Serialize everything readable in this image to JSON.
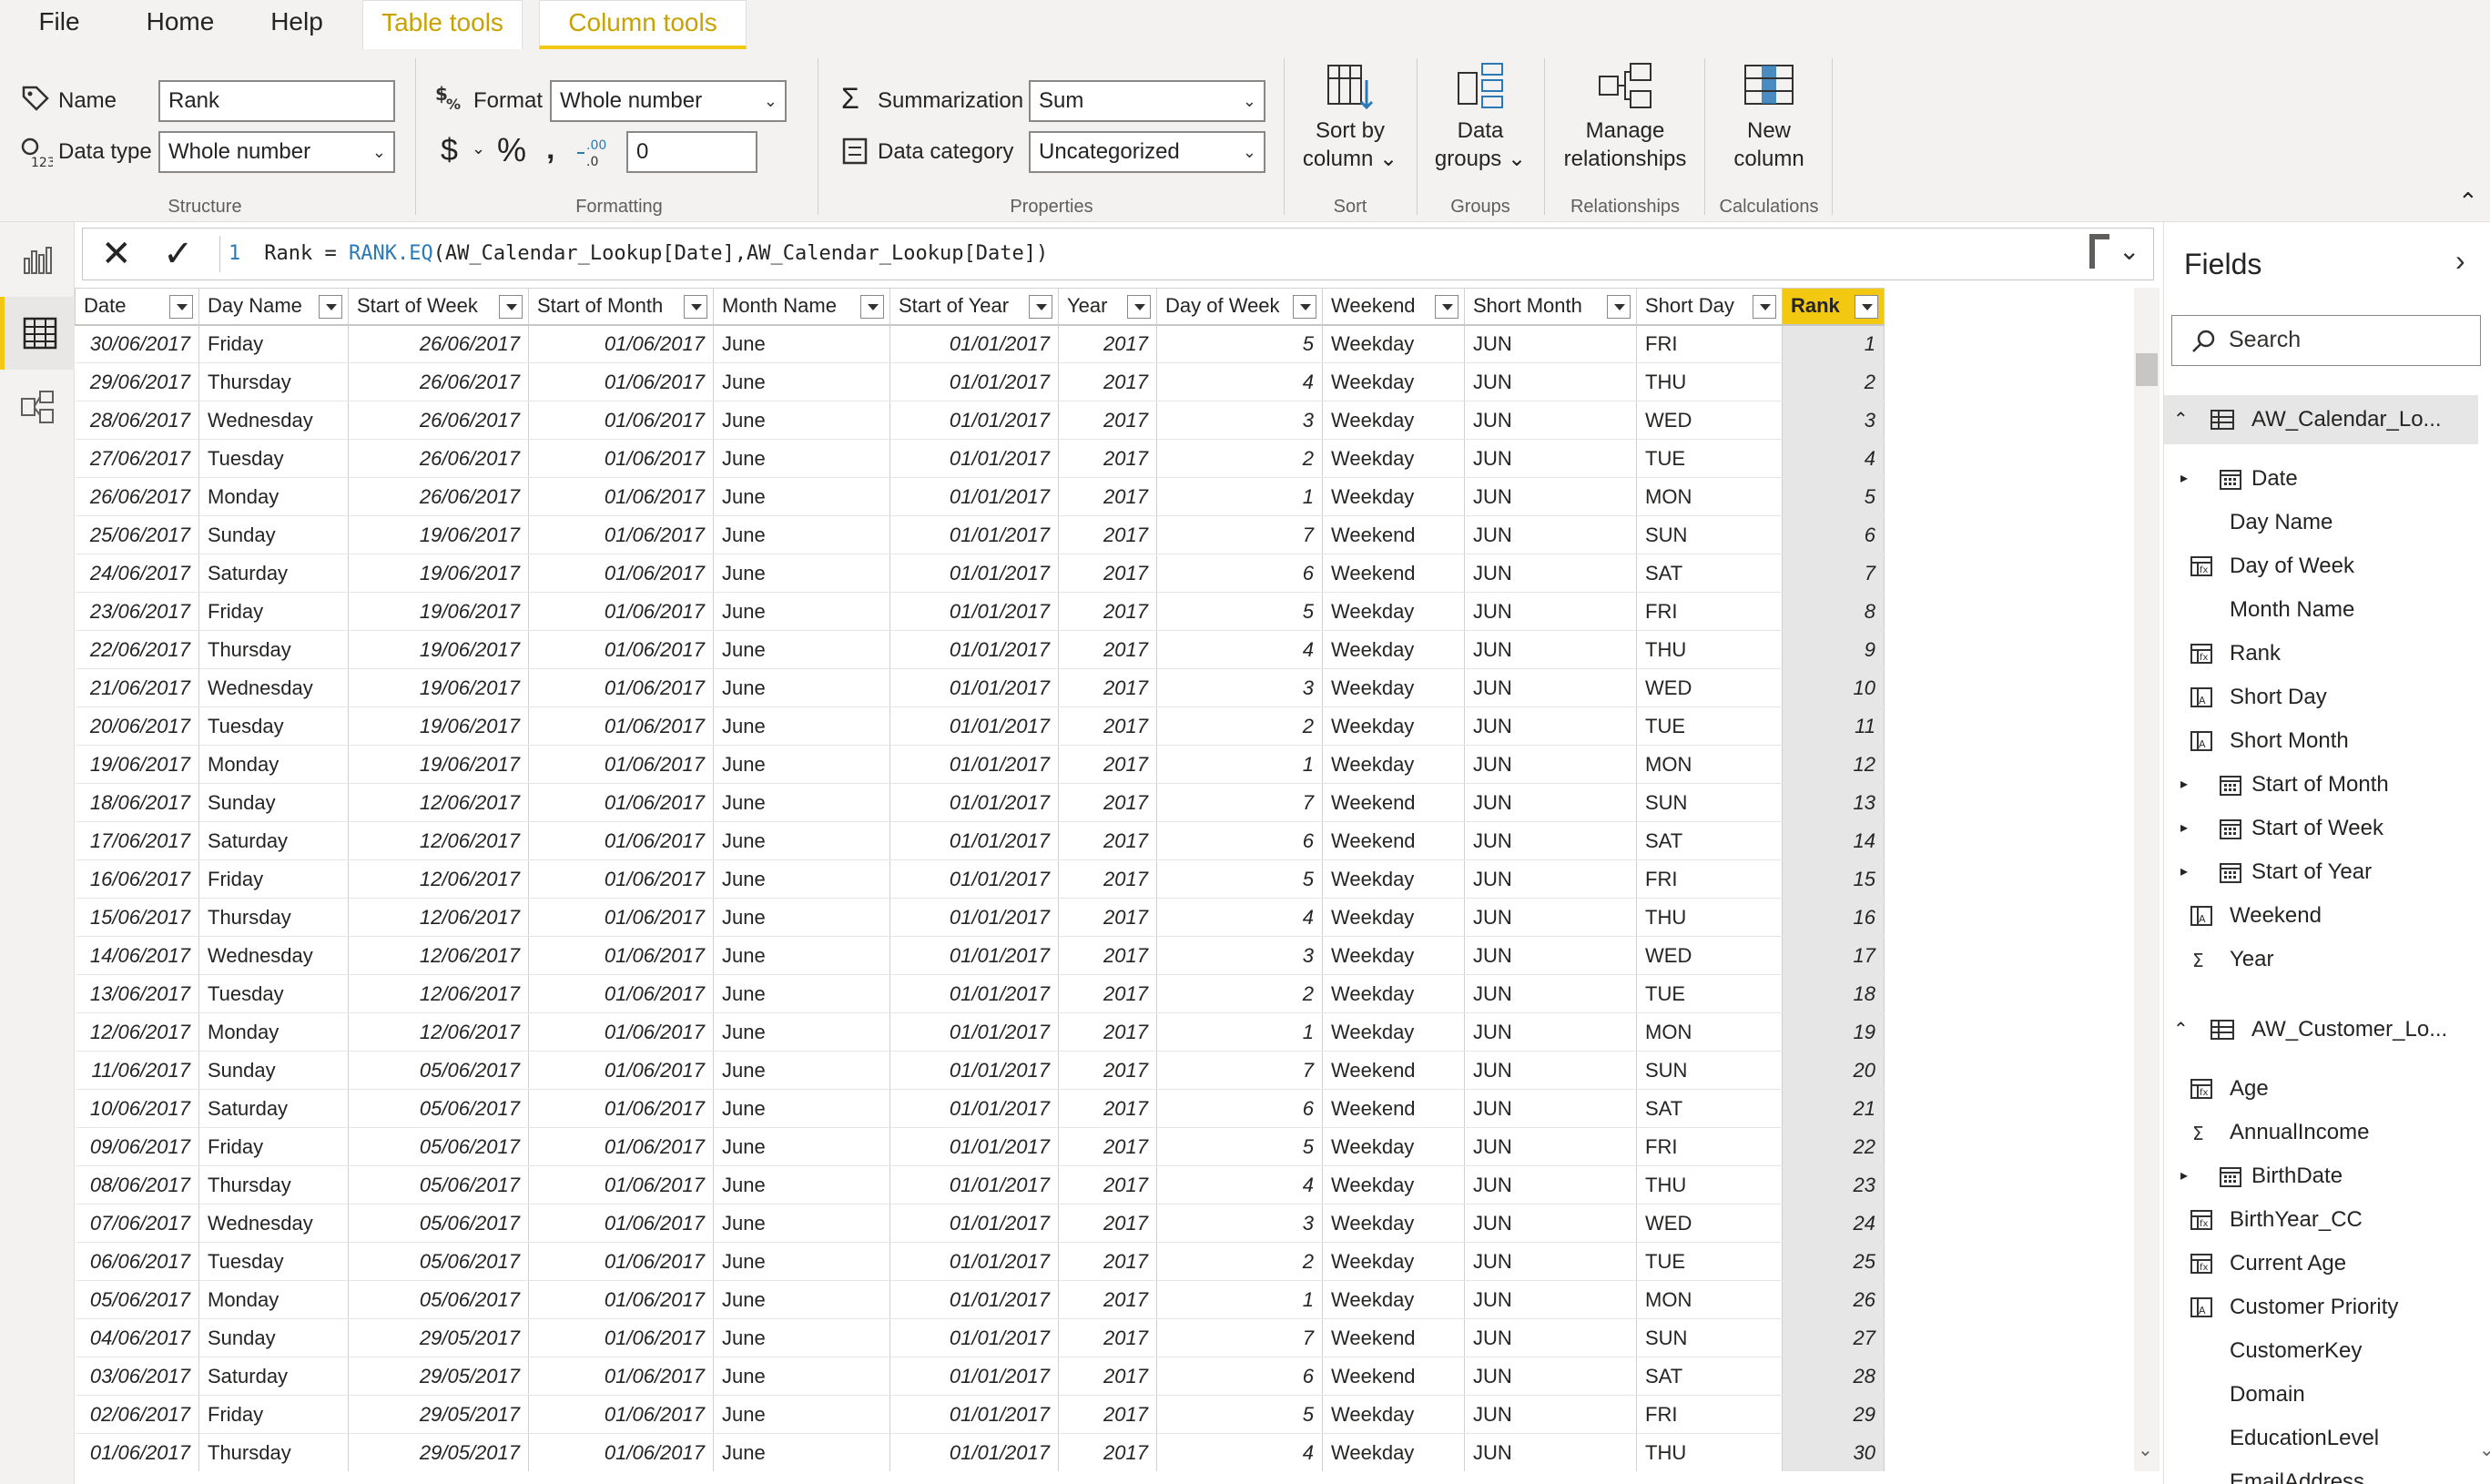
{
  "tabs": [
    {
      "label": "File"
    },
    {
      "label": "Home"
    },
    {
      "label": "Help"
    },
    {
      "label": "Table tools"
    },
    {
      "label": "Column tools"
    }
  ],
  "structure": {
    "name_label": "Name",
    "name_value": "Rank",
    "datatype_label": "Data type",
    "datatype_value": "Whole number",
    "group_label": "Structure"
  },
  "formatting": {
    "format_label": "Format",
    "format_value": "Whole number",
    "decimals_value": "0",
    "group_label": "Formatting"
  },
  "properties": {
    "summarization_label": "Summarization",
    "summarization_value": "Sum",
    "category_label": "Data category",
    "category_value": "Uncategorized",
    "group_label": "Properties"
  },
  "sort": {
    "line1": "Sort by",
    "line2": "column",
    "group_label": "Sort"
  },
  "groups": {
    "line1": "Data",
    "line2": "groups",
    "group_label": "Groups"
  },
  "relationships": {
    "line1": "Manage",
    "line2": "relationships",
    "group_label": "Relationships"
  },
  "calculations": {
    "line1": "New",
    "line2": "column",
    "group_label": "Calculations"
  },
  "formula": {
    "line_number": "1",
    "prefix": "Rank = ",
    "function": "RANK.EQ",
    "args": "(AW_Calendar_Lookup[Date],AW_Calendar_Lookup[Date])"
  },
  "table": {
    "columns": [
      "Date",
      "Day Name",
      "Start of Week",
      "Start of Month",
      "Month Name",
      "Start of Year",
      "Year",
      "Day of Week",
      "Weekend",
      "Short Month",
      "Short Day",
      "Rank"
    ],
    "rows": [
      [
        "30/06/2017",
        "Friday",
        "26/06/2017",
        "01/06/2017",
        "June",
        "01/01/2017",
        "2017",
        "5",
        "Weekday",
        "JUN",
        "FRI",
        "1"
      ],
      [
        "29/06/2017",
        "Thursday",
        "26/06/2017",
        "01/06/2017",
        "June",
        "01/01/2017",
        "2017",
        "4",
        "Weekday",
        "JUN",
        "THU",
        "2"
      ],
      [
        "28/06/2017",
        "Wednesday",
        "26/06/2017",
        "01/06/2017",
        "June",
        "01/01/2017",
        "2017",
        "3",
        "Weekday",
        "JUN",
        "WED",
        "3"
      ],
      [
        "27/06/2017",
        "Tuesday",
        "26/06/2017",
        "01/06/2017",
        "June",
        "01/01/2017",
        "2017",
        "2",
        "Weekday",
        "JUN",
        "TUE",
        "4"
      ],
      [
        "26/06/2017",
        "Monday",
        "26/06/2017",
        "01/06/2017",
        "June",
        "01/01/2017",
        "2017",
        "1",
        "Weekday",
        "JUN",
        "MON",
        "5"
      ],
      [
        "25/06/2017",
        "Sunday",
        "19/06/2017",
        "01/06/2017",
        "June",
        "01/01/2017",
        "2017",
        "7",
        "Weekend",
        "JUN",
        "SUN",
        "6"
      ],
      [
        "24/06/2017",
        "Saturday",
        "19/06/2017",
        "01/06/2017",
        "June",
        "01/01/2017",
        "2017",
        "6",
        "Weekend",
        "JUN",
        "SAT",
        "7"
      ],
      [
        "23/06/2017",
        "Friday",
        "19/06/2017",
        "01/06/2017",
        "June",
        "01/01/2017",
        "2017",
        "5",
        "Weekday",
        "JUN",
        "FRI",
        "8"
      ],
      [
        "22/06/2017",
        "Thursday",
        "19/06/2017",
        "01/06/2017",
        "June",
        "01/01/2017",
        "2017",
        "4",
        "Weekday",
        "JUN",
        "THU",
        "9"
      ],
      [
        "21/06/2017",
        "Wednesday",
        "19/06/2017",
        "01/06/2017",
        "June",
        "01/01/2017",
        "2017",
        "3",
        "Weekday",
        "JUN",
        "WED",
        "10"
      ],
      [
        "20/06/2017",
        "Tuesday",
        "19/06/2017",
        "01/06/2017",
        "June",
        "01/01/2017",
        "2017",
        "2",
        "Weekday",
        "JUN",
        "TUE",
        "11"
      ],
      [
        "19/06/2017",
        "Monday",
        "19/06/2017",
        "01/06/2017",
        "June",
        "01/01/2017",
        "2017",
        "1",
        "Weekday",
        "JUN",
        "MON",
        "12"
      ],
      [
        "18/06/2017",
        "Sunday",
        "12/06/2017",
        "01/06/2017",
        "June",
        "01/01/2017",
        "2017",
        "7",
        "Weekend",
        "JUN",
        "SUN",
        "13"
      ],
      [
        "17/06/2017",
        "Saturday",
        "12/06/2017",
        "01/06/2017",
        "June",
        "01/01/2017",
        "2017",
        "6",
        "Weekend",
        "JUN",
        "SAT",
        "14"
      ],
      [
        "16/06/2017",
        "Friday",
        "12/06/2017",
        "01/06/2017",
        "June",
        "01/01/2017",
        "2017",
        "5",
        "Weekday",
        "JUN",
        "FRI",
        "15"
      ],
      [
        "15/06/2017",
        "Thursday",
        "12/06/2017",
        "01/06/2017",
        "June",
        "01/01/2017",
        "2017",
        "4",
        "Weekday",
        "JUN",
        "THU",
        "16"
      ],
      [
        "14/06/2017",
        "Wednesday",
        "12/06/2017",
        "01/06/2017",
        "June",
        "01/01/2017",
        "2017",
        "3",
        "Weekday",
        "JUN",
        "WED",
        "17"
      ],
      [
        "13/06/2017",
        "Tuesday",
        "12/06/2017",
        "01/06/2017",
        "June",
        "01/01/2017",
        "2017",
        "2",
        "Weekday",
        "JUN",
        "TUE",
        "18"
      ],
      [
        "12/06/2017",
        "Monday",
        "12/06/2017",
        "01/06/2017",
        "June",
        "01/01/2017",
        "2017",
        "1",
        "Weekday",
        "JUN",
        "MON",
        "19"
      ],
      [
        "11/06/2017",
        "Sunday",
        "05/06/2017",
        "01/06/2017",
        "June",
        "01/01/2017",
        "2017",
        "7",
        "Weekend",
        "JUN",
        "SUN",
        "20"
      ],
      [
        "10/06/2017",
        "Saturday",
        "05/06/2017",
        "01/06/2017",
        "June",
        "01/01/2017",
        "2017",
        "6",
        "Weekend",
        "JUN",
        "SAT",
        "21"
      ],
      [
        "09/06/2017",
        "Friday",
        "05/06/2017",
        "01/06/2017",
        "June",
        "01/01/2017",
        "2017",
        "5",
        "Weekday",
        "JUN",
        "FRI",
        "22"
      ],
      [
        "08/06/2017",
        "Thursday",
        "05/06/2017",
        "01/06/2017",
        "June",
        "01/01/2017",
        "2017",
        "4",
        "Weekday",
        "JUN",
        "THU",
        "23"
      ],
      [
        "07/06/2017",
        "Wednesday",
        "05/06/2017",
        "01/06/2017",
        "June",
        "01/01/2017",
        "2017",
        "3",
        "Weekday",
        "JUN",
        "WED",
        "24"
      ],
      [
        "06/06/2017",
        "Tuesday",
        "05/06/2017",
        "01/06/2017",
        "June",
        "01/01/2017",
        "2017",
        "2",
        "Weekday",
        "JUN",
        "TUE",
        "25"
      ],
      [
        "05/06/2017",
        "Monday",
        "05/06/2017",
        "01/06/2017",
        "June",
        "01/01/2017",
        "2017",
        "1",
        "Weekday",
        "JUN",
        "MON",
        "26"
      ],
      [
        "04/06/2017",
        "Sunday",
        "29/05/2017",
        "01/06/2017",
        "June",
        "01/01/2017",
        "2017",
        "7",
        "Weekend",
        "JUN",
        "SUN",
        "27"
      ],
      [
        "03/06/2017",
        "Saturday",
        "29/05/2017",
        "01/06/2017",
        "June",
        "01/01/2017",
        "2017",
        "6",
        "Weekend",
        "JUN",
        "SAT",
        "28"
      ],
      [
        "02/06/2017",
        "Friday",
        "29/05/2017",
        "01/06/2017",
        "June",
        "01/01/2017",
        "2017",
        "5",
        "Weekday",
        "JUN",
        "FRI",
        "29"
      ],
      [
        "01/06/2017",
        "Thursday",
        "29/05/2017",
        "01/06/2017",
        "June",
        "01/01/2017",
        "2017",
        "4",
        "Weekday",
        "JUN",
        "THU",
        "30"
      ]
    ]
  },
  "fields": {
    "title": "Fields",
    "search_placeholder": "Search",
    "tables": [
      {
        "name": "AW_Calendar_Lo...",
        "items": [
          {
            "label": "Date",
            "icon": "calendar-icon",
            "expandable": true
          },
          {
            "label": "Day Name",
            "icon": "",
            "expandable": false
          },
          {
            "label": "Day of Week",
            "icon": "calculated-column-icon",
            "expandable": false
          },
          {
            "label": "Month Name",
            "icon": "",
            "expandable": false
          },
          {
            "label": "Rank",
            "icon": "calculated-column-icon",
            "expandable": false
          },
          {
            "label": "Short Day",
            "icon": "text-calculated-column-icon",
            "expandable": false
          },
          {
            "label": "Short Month",
            "icon": "text-calculated-column-icon",
            "expandable": false
          },
          {
            "label": "Start of Month",
            "icon": "calendar-icon",
            "expandable": true
          },
          {
            "label": "Start of Week",
            "icon": "calendar-icon",
            "expandable": true
          },
          {
            "label": "Start of Year",
            "icon": "calendar-icon",
            "expandable": true
          },
          {
            "label": "Weekend",
            "icon": "text-calculated-column-icon",
            "expandable": false
          },
          {
            "label": "Year",
            "icon": "sigma-icon",
            "expandable": false
          }
        ]
      },
      {
        "name": "AW_Customer_Lo...",
        "items": [
          {
            "label": "Age",
            "icon": "calculated-column-icon",
            "expandable": false
          },
          {
            "label": "AnnualIncome",
            "icon": "sigma-icon",
            "expandable": false
          },
          {
            "label": "BirthDate",
            "icon": "calendar-icon",
            "expandable": true
          },
          {
            "label": "BirthYear_CC",
            "icon": "calculated-column-icon",
            "expandable": false
          },
          {
            "label": "Current Age",
            "icon": "calculated-column-icon",
            "expandable": false
          },
          {
            "label": "Customer Priority",
            "icon": "text-calculated-column-icon",
            "expandable": false
          },
          {
            "label": "CustomerKey",
            "icon": "",
            "expandable": false
          },
          {
            "label": "Domain",
            "icon": "",
            "expandable": false
          },
          {
            "label": "EducationLevel",
            "icon": "",
            "expandable": false
          },
          {
            "label": "EmailAddress",
            "icon": "",
            "expandable": false
          }
        ]
      }
    ]
  },
  "colors": {
    "accent": "#f2c811",
    "context_tab_text": "#c8a205",
    "code_function": "#2b7ab8"
  }
}
